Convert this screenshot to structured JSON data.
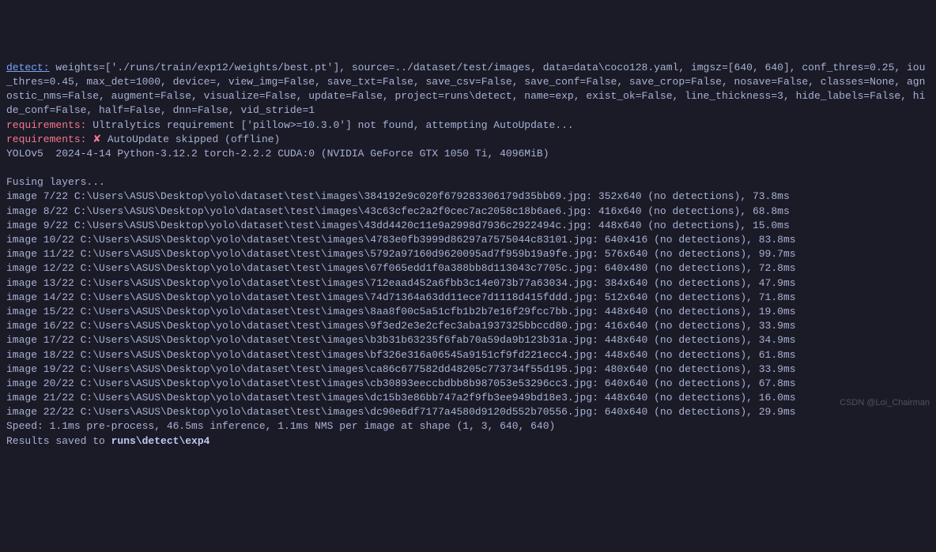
{
  "detect": {
    "label": "detect:",
    "params": " weights=['./runs/train/exp12/weights/best.pt'], source=../dataset/test/images, data=data\\coco128.yaml, imgsz=[640, 640], conf_thres=0.25, iou_thres=0.45, max_det=1000, device=, view_img=False, save_txt=False, save_csv=False, save_conf=False, save_crop=False, nosave=False, classes=None, agnostic_nms=False, augment=False, visualize=False, update=False, project=runs\\detect, name=exp, exist_ok=False, line_thickness=3, hide_labels=False, hide_conf=False, half=False, dnn=False, vid_stride=1"
  },
  "req1": {
    "label": "requirements:",
    "text": " Ultralytics requirement ['pillow>=10.3.0'] not found, attempting AutoUpdate..."
  },
  "req2": {
    "label": "requirements:",
    "icon": " ✘ ",
    "text": "AutoUpdate skipped (offline)"
  },
  "version": "YOLOv5  2024-4-14 Python-3.12.2 torch-2.2.2 CUDA:0 (NVIDIA GeForce GTX 1050 Ti, 4096MiB)",
  "fusing": "Fusing layers...",
  "images": [
    {
      "line": "image 7/22 C:\\Users\\ASUS\\Desktop\\yolo\\dataset\\test\\images\\384192e9c020f679283306179d35bb69.jpg: 352x640 (no detections), 73.8ms"
    },
    {
      "line": "image 8/22 C:\\Users\\ASUS\\Desktop\\yolo\\dataset\\test\\images\\43c63cfec2a2f0cec7ac2058c18b6ae6.jpg: 416x640 (no detections), 68.8ms"
    },
    {
      "line": "image 9/22 C:\\Users\\ASUS\\Desktop\\yolo\\dataset\\test\\images\\43dd4420c11e9a2998d7936c2922494c.jpg: 448x640 (no detections), 15.0ms"
    },
    {
      "line": "image 10/22 C:\\Users\\ASUS\\Desktop\\yolo\\dataset\\test\\images\\4783e0fb3999d86297a7575044c83101.jpg: 640x416 (no detections), 83.8ms"
    },
    {
      "line": "image 11/22 C:\\Users\\ASUS\\Desktop\\yolo\\dataset\\test\\images\\5792a97160d9620095ad7f959b19a9fe.jpg: 576x640 (no detections), 99.7ms"
    },
    {
      "line": "image 12/22 C:\\Users\\ASUS\\Desktop\\yolo\\dataset\\test\\images\\67f065edd1f0a388bb8d113043c7705c.jpg: 640x480 (no detections), 72.8ms"
    },
    {
      "line": "image 13/22 C:\\Users\\ASUS\\Desktop\\yolo\\dataset\\test\\images\\712eaad452a6fbb3c14e073b77a63034.jpg: 384x640 (no detections), 47.9ms"
    },
    {
      "line": "image 14/22 C:\\Users\\ASUS\\Desktop\\yolo\\dataset\\test\\images\\74d71364a63dd11ece7d1118d415fddd.jpg: 512x640 (no detections), 71.8ms"
    },
    {
      "line": "image 15/22 C:\\Users\\ASUS\\Desktop\\yolo\\dataset\\test\\images\\8aa8f00c5a51cfb1b2b7e16f29fcc7bb.jpg: 448x640 (no detections), 19.0ms"
    },
    {
      "line": "image 16/22 C:\\Users\\ASUS\\Desktop\\yolo\\dataset\\test\\images\\9f3ed2e3e2cfec3aba1937325bbccd80.jpg: 416x640 (no detections), 33.9ms"
    },
    {
      "line": "image 17/22 C:\\Users\\ASUS\\Desktop\\yolo\\dataset\\test\\images\\b3b31b63235f6fab70a59da9b123b31a.jpg: 448x640 (no detections), 34.9ms"
    },
    {
      "line": "image 18/22 C:\\Users\\ASUS\\Desktop\\yolo\\dataset\\test\\images\\bf326e316a06545a9151cf9fd221ecc4.jpg: 448x640 (no detections), 61.8ms"
    },
    {
      "line": "image 19/22 C:\\Users\\ASUS\\Desktop\\yolo\\dataset\\test\\images\\ca86c677582dd48205c773734f55d195.jpg: 480x640 (no detections), 33.9ms"
    },
    {
      "line": "image 20/22 C:\\Users\\ASUS\\Desktop\\yolo\\dataset\\test\\images\\cb30893eeccbdbb8b987053e53296cc3.jpg: 640x640 (no detections), 67.8ms"
    },
    {
      "line": "image 21/22 C:\\Users\\ASUS\\Desktop\\yolo\\dataset\\test\\images\\dc15b3e86bb747a2f9fb3ee949bd18e3.jpg: 448x640 (no detections), 16.0ms"
    },
    {
      "line": "image 22/22 C:\\Users\\ASUS\\Desktop\\yolo\\dataset\\test\\images\\dc90e6df7177a4580d9120d552b70556.jpg: 640x640 (no detections), 29.9ms"
    }
  ],
  "speed": "Speed: 1.1ms pre-process, 46.5ms inference, 1.1ms NMS per image at shape (1, 3, 640, 640)",
  "results": {
    "prefix": "Results saved to ",
    "path": "runs\\detect\\exp4"
  },
  "watermark": "CSDN @Loi_Chairman"
}
